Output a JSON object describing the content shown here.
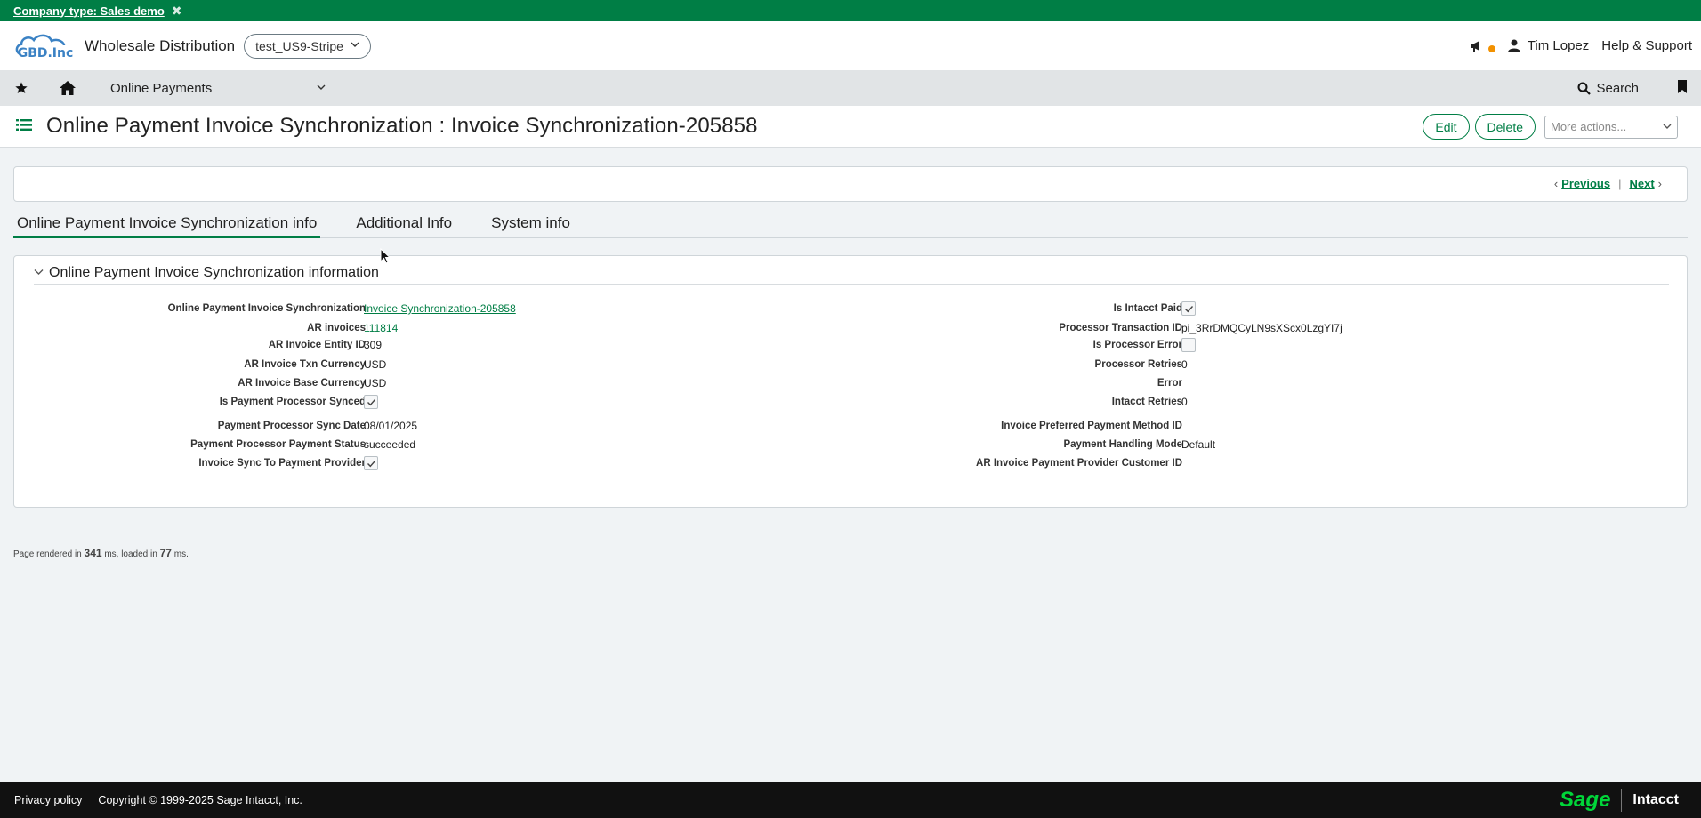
{
  "banner": {
    "text": "Company type: Sales demo"
  },
  "header": {
    "company_name": "Wholesale Distribution",
    "entity": "test_US9-Stripe",
    "user": "Tim Lopez",
    "help": "Help & Support"
  },
  "nav": {
    "module": "Online Payments",
    "search": "Search"
  },
  "title": {
    "text": "Online Payment Invoice Synchronization : Invoice Synchronization-205858",
    "edit": "Edit",
    "delete": "Delete",
    "more_actions_placeholder": "More actions..."
  },
  "pager": {
    "previous": "Previous",
    "next": "Next",
    "separator": "|"
  },
  "tabs": [
    "Online Payment Invoice Synchronization info",
    "Additional Info",
    "System info"
  ],
  "section": {
    "heading": "Online Payment Invoice Synchronization information",
    "left": [
      {
        "label": "Online Payment Invoice Synchronization",
        "value": "Invoice Synchronization-205858",
        "type": "link"
      },
      {
        "label": "AR invoices",
        "value": "111814",
        "type": "link"
      },
      {
        "label": "AR Invoice Entity ID",
        "value": "309",
        "type": "text"
      },
      {
        "label": "AR Invoice Txn Currency",
        "value": "USD",
        "type": "text"
      },
      {
        "label": "AR Invoice Base Currency",
        "value": "USD",
        "type": "text"
      },
      {
        "label": "Is Payment Processor Synced",
        "value": "checked",
        "type": "checkbox"
      },
      {
        "label": "Payment Processor Sync Date",
        "value": "08/01/2025",
        "type": "text"
      },
      {
        "label": "Payment Processor Payment Status",
        "value": "succeeded",
        "type": "text"
      },
      {
        "label": "Invoice Sync To Payment Provider",
        "value": "checked",
        "type": "checkbox"
      }
    ],
    "right": [
      {
        "label": "Is Intacct Paid",
        "value": "checked",
        "type": "checkbox"
      },
      {
        "label": "Processor Transaction ID",
        "value": "pi_3RrDMQCyLN9sXScx0LzgYI7j",
        "type": "text"
      },
      {
        "label": "Is Processor Error",
        "value": "unchecked",
        "type": "checkbox"
      },
      {
        "label": "Processor Retries",
        "value": "0",
        "type": "text"
      },
      {
        "label": "Error",
        "value": "",
        "type": "text"
      },
      {
        "label": "Intacct Retries",
        "value": "0",
        "type": "text"
      },
      {
        "label": "Invoice Preferred Payment Method ID",
        "value": "",
        "type": "text"
      },
      {
        "label": "Payment Handling Mode",
        "value": "Default",
        "type": "text"
      },
      {
        "label": "AR Invoice Payment Provider Customer ID",
        "value": "",
        "type": "text"
      }
    ]
  },
  "perf": {
    "prefix": "Page rendered in",
    "rendered_ms": "341",
    "middle": "ms, loaded in",
    "loaded_ms": "77",
    "suffix": "ms."
  },
  "footer": {
    "privacy": "Privacy policy",
    "copyright": "Copyright © 1999-2025 Sage Intacct, Inc.",
    "brand1": "Sage",
    "brand2": "Intacct"
  },
  "colors": {
    "brand_green": "#007e45",
    "sage_green": "#00d639",
    "badge": "#f29100"
  },
  "icons": [
    "close-icon",
    "announcement-icon",
    "user-icon",
    "star-icon",
    "home-icon",
    "chevron-down-icon",
    "search-icon",
    "bookmark-icon",
    "list-icon",
    "check-icon",
    "cursor-icon"
  ]
}
